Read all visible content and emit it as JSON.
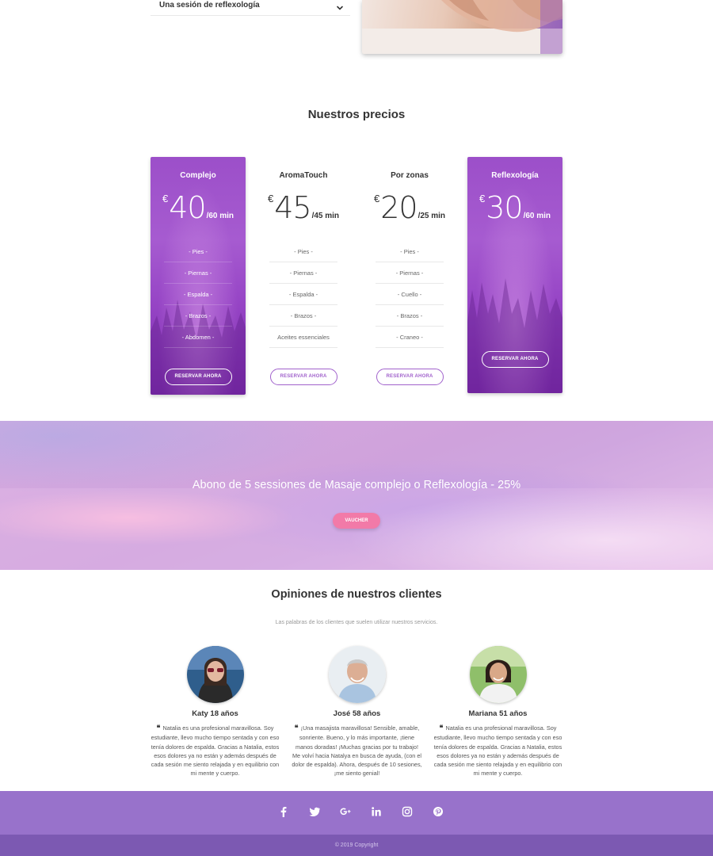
{
  "accordion": {
    "label": "Una sesión de reflexología"
  },
  "pricing": {
    "title": "Nuestros precios",
    "cards": [
      {
        "name": "Complejo",
        "currency": "€",
        "amount": "40",
        "per": "/60 min",
        "featured": true,
        "features": [
          "- Pies -",
          "- Piernas -",
          "- Espalda -",
          "- Brazos -",
          "- Abdomen -"
        ],
        "button": "RESERVAR AHORA"
      },
      {
        "name": "AromaTouch",
        "currency": "€",
        "amount": "45",
        "per": "/45 min",
        "featured": false,
        "features": [
          "- Pies -",
          "- Piernas -",
          "- Espalda -",
          "- Brazos -",
          "Aceites essenciales"
        ],
        "button": "RESERVAR AHORA"
      },
      {
        "name": "Por zonas",
        "currency": "€",
        "amount": "20",
        "per": "/25 min",
        "featured": false,
        "features": [
          "- Pies -",
          "- Piernas -",
          "- Cuello -",
          "- Brazos -",
          "- Craneo -"
        ],
        "button": "RESERVAR AHORA"
      },
      {
        "name": "Reflexología",
        "currency": "€",
        "amount": "30",
        "per": "/60 min",
        "featured": true,
        "features": [],
        "button": "RESERVAR AHORA"
      }
    ]
  },
  "promo": {
    "title": "Abono de 5 sessiones de Masaje complejo o Reflexología - 25%",
    "button": "VAUCHER"
  },
  "testimonials": {
    "title": "Opiniones de nuestros clientes",
    "subtitle": "Las palabras de los clientes que suelen utilizar nuestros servicios.",
    "items": [
      {
        "name": "Katy 18 años",
        "text": "Natalia es una profesional maravillosa. Soy estudiante, llevo mucho tiempo sentada y con eso tenía dolores de espalda. Gracias a Natalia, estos esos dolores ya no están y además después de cada sesión me siento relajada y en equilibrio con mi mente y cuerpo."
      },
      {
        "name": "José 58 años",
        "text": "¡Una masajista maravillosa! Sensible, amable, sonriente. Bueno, y lo más importante, ¡tiene manos doradas! ¡Muchas gracias por tu trabajo! Me volví hacia Natalya en busca de ayuda, (con el dolor de espalda). Ahora, después de 10 sesiones, ¡me siento genial!"
      },
      {
        "name": "Mariana 51 años",
        "text": "Natalia es una profesional maravillosa. Soy estudiante, llevo mucho tiempo sentada y con eso tenía dolores de espalda. Gracias a Natalia, estos esos dolores ya no están y además después de cada sesión me siento relajada y en equilibrio con mi mente y cuerpo."
      }
    ]
  },
  "footer": {
    "socials": [
      "facebook-icon",
      "twitter-icon",
      "google-plus-icon",
      "linkedin-icon",
      "instagram-icon",
      "pinterest-icon"
    ],
    "copyright": "© 2019 Copyright"
  },
  "colors": {
    "accent_purple": "#9c4fc9",
    "footer_top": "#9872cb",
    "footer_bottom": "#7c59b2",
    "voucher_pink": "#f27aa8"
  }
}
